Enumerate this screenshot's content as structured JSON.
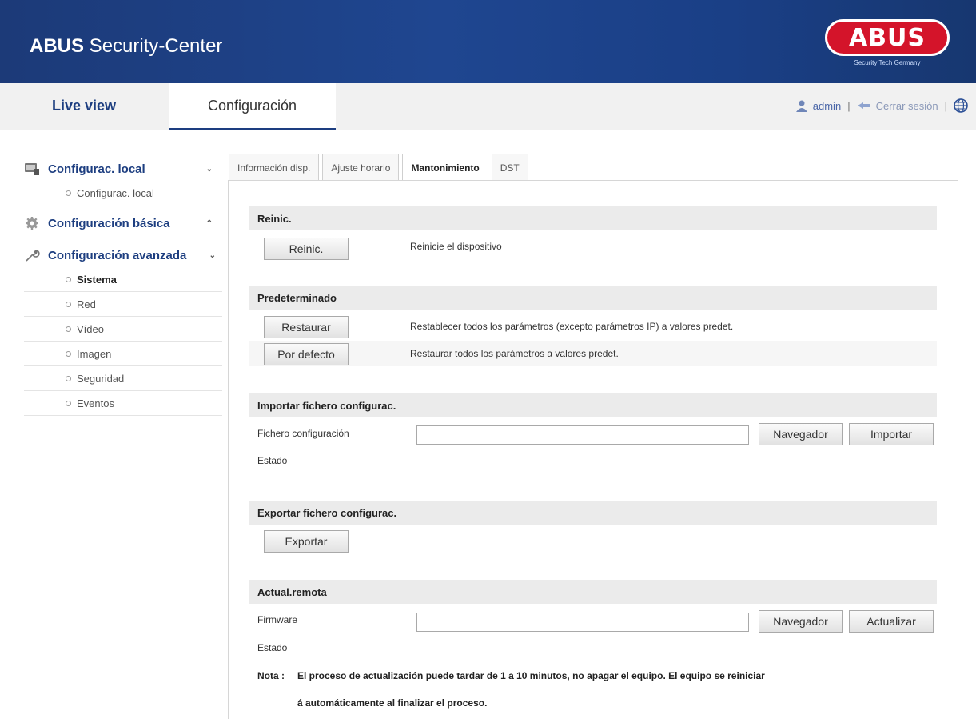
{
  "header": {
    "brand_bold": "ABUS",
    "brand_rest": " Security-Center",
    "logo_text": "ABUS",
    "logo_sub": "Security Tech Germany",
    "bg_color": "#1f4690"
  },
  "topnav": {
    "live_view": "Live view",
    "configuracion": "Configuración",
    "user": "admin",
    "logout": "Cerrar sesión",
    "sep": "|"
  },
  "sidebar": {
    "local_group": "Configurac. local",
    "local_item": "Configurac. local",
    "basic_group": "Configuración básica",
    "advanced_group": "Configuración avanzada",
    "items": [
      "Sistema",
      "Red",
      "Vídeo",
      "Imagen",
      "Seguridad",
      "Eventos"
    ]
  },
  "tabs": [
    "Información disp.",
    "Ajuste horario",
    "Mantonimiento",
    "DST"
  ],
  "reinic": {
    "title": "Reinic.",
    "button": "Reinic.",
    "desc": "Reinicie el dispositivo"
  },
  "predeterminado": {
    "title": "Predeterminado",
    "restaurar_button": "Restaurar",
    "restaurar_desc": "Restablecer todos los parámetros (excepto parámetros IP) a valores predet.",
    "defecto_button": "Por defecto",
    "defecto_desc": "Restaurar todos los parámetros a valores predet."
  },
  "importar": {
    "title": "Importar fichero configurac.",
    "file_label": "Fichero configuración",
    "browse": "Navegador",
    "import": "Importar",
    "status_label": "Estado",
    "file_value": ""
  },
  "exportar": {
    "title": "Exportar fichero configurac.",
    "button": "Exportar"
  },
  "actual": {
    "title": "Actual.remota",
    "file_label": "Firmware",
    "browse": "Navegador",
    "update": "Actualizar",
    "status_label": "Estado",
    "file_value": "",
    "note_label": "Nota :",
    "note_line1": "El proceso de actualización puede tardar de 1 a 10 minutos, no apagar el equipo. El equipo se reiniciar",
    "note_line2": "á automáticamente al finalizar el proceso."
  }
}
